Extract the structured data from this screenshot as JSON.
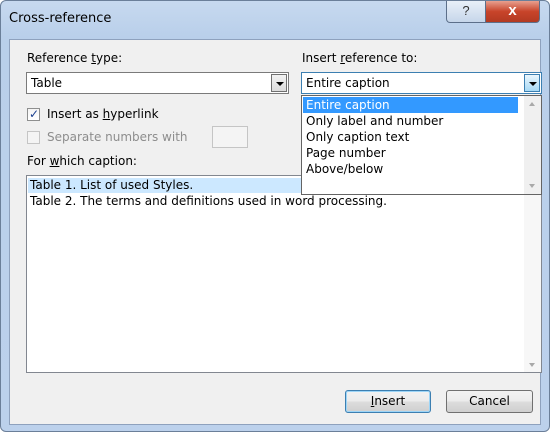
{
  "dialog": {
    "title": "Cross-reference",
    "help_glyph": "?",
    "close_glyph": "x"
  },
  "reference_type": {
    "label_pre": "Reference ",
    "label_ul": "t",
    "label_post": "ype:",
    "value": "Table"
  },
  "insert_reference_to": {
    "label_pre": "Insert ",
    "label_ul": "r",
    "label_post": "eference to:",
    "value": "Entire caption",
    "options": [
      "Entire caption",
      "Only label and number",
      "Only caption text",
      "Page number",
      "Above/below"
    ]
  },
  "insert_as_hyperlink": {
    "label_pre": "Insert as ",
    "label_ul": "h",
    "label_post": "yperlink",
    "checked": true,
    "check_glyph": "✓"
  },
  "separate_numbers": {
    "label": "Separate numbers with",
    "checked": false
  },
  "caption_list": {
    "label_pre": "For ",
    "label_ul": "w",
    "label_post": "hich caption:",
    "items": [
      "Table 1. List of used Styles.",
      "Table 2. The terms and definitions used in word processing."
    ]
  },
  "buttons": {
    "insert_ul": "I",
    "insert_post": "nsert",
    "cancel": "Cancel"
  }
}
